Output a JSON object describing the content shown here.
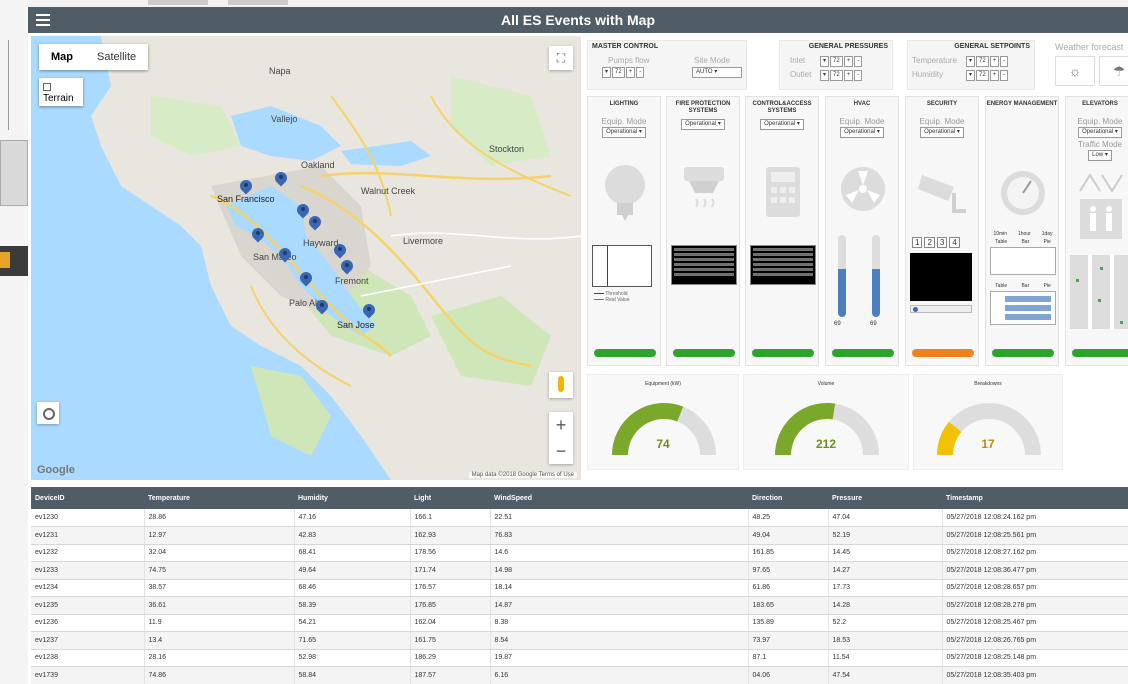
{
  "app": {
    "title": "All ES Events with Map"
  },
  "map": {
    "type_tabs": [
      "Map",
      "Satellite"
    ],
    "terrain_label": "Terrain",
    "google_logo": "Google",
    "terms": "Map data ©2018 Google  Terms of Use",
    "zoom_in": "+",
    "zoom_out": "−",
    "labels": [
      "San Francisco",
      "San Jose",
      "Oakland",
      "Hayward",
      "Fremont",
      "Walnut Creek",
      "Stockton",
      "Napa",
      "Vallejo",
      "Palo Alto",
      "San Mateo",
      "Livermore"
    ],
    "pin_count": 11
  },
  "master": {
    "header": "MASTER CONTROL",
    "pumps_label": "Pumps flow",
    "pumps_value": "72",
    "site_label": "Site Mode",
    "site_value": "AUTO"
  },
  "pressures": {
    "header": "GENERAL PRESSURES",
    "inlet_label": "Inlet",
    "inlet_value": "72",
    "outlet_label": "Outlet",
    "outlet_value": "72"
  },
  "setpoints": {
    "header": "GENERAL SETPOINTS",
    "temp_label": "Temperature",
    "temp_value": "72",
    "hum_label": "Humidity",
    "hum_value": "72"
  },
  "weather": {
    "label": "Weather forecast"
  },
  "systems": [
    {
      "name": "LIGHTING",
      "mode_label": "Equip. Mode",
      "mode": "Operational",
      "status": "green",
      "legend1": "Threshold",
      "legend2": "Real Value"
    },
    {
      "name": "FIRE PROTECTION SYSTEMS",
      "mode_label": "Equip. Mode",
      "mode": "Operational",
      "status": "green"
    },
    {
      "name": "CONTROL&ACCESS SYSTEMS",
      "mode_label": "Equip. Mode",
      "mode": "Operational",
      "status": "green"
    },
    {
      "name": "HVAC",
      "mode_label": "Equip. Mode",
      "mode": "Operational",
      "status": "green",
      "t1": "69",
      "t2": "69"
    },
    {
      "name": "SECURITY",
      "mode_label": "Equip. Mode",
      "mode": "Operational",
      "status": "orange",
      "cams": [
        "1",
        "2",
        "3",
        "4"
      ]
    },
    {
      "name": "ENERGY MANAGEMENT",
      "status": "green",
      "tabs": [
        "10min",
        "1hour",
        "1day"
      ],
      "table_tabs": [
        "Table",
        "Bar",
        "Pie"
      ]
    },
    {
      "name": "ELEVATORS",
      "mode_label": "Equip. Mode",
      "mode": "Operational",
      "traffic_label": "Traffic Mode",
      "traffic": "Low",
      "status": "green"
    }
  ],
  "gauges": [
    {
      "title": "Equipment (kW)",
      "value": "74",
      "fraction": 0.62,
      "color": "#7aa82a"
    },
    {
      "title": "Volume",
      "value": "212",
      "fraction": 0.55,
      "color": "#7aa82a"
    },
    {
      "title": "Breakdowns",
      "value": "17",
      "fraction": 0.22,
      "color": "#f2c200"
    }
  ],
  "table": {
    "columns": [
      "DeviceID",
      "Temperature",
      "Humidity",
      "Light",
      "WindSpeed",
      "Direction",
      "Pressure",
      "Timestamp"
    ],
    "rows": [
      [
        "ev1230",
        "28.86",
        "47.16",
        "166.1",
        "22.51",
        "48.25",
        "47.04",
        "05/27/2018 12:08:24.162 pm"
      ],
      [
        "ev1231",
        "12.97",
        "42.83",
        "162.93",
        "76.83",
        "49.04",
        "52.19",
        "05/27/2018 12:08:25.561 pm"
      ],
      [
        "ev1232",
        "32.04",
        "68.41",
        "178.56",
        "14.6",
        "161.85",
        "14.45",
        "05/27/2018 12:08:27.162 pm"
      ],
      [
        "ev1233",
        "74.75",
        "49.64",
        "171.74",
        "14.98",
        "97.65",
        "14.27",
        "05/27/2018 12:08:36.477 pm"
      ],
      [
        "ev1234",
        "38.57",
        "68.46",
        "176.57",
        "18.14",
        "61.86",
        "17.73",
        "05/27/2018 12:08:28.657 pm"
      ],
      [
        "ev1235",
        "36.61",
        "58.39",
        "176.85",
        "14.87",
        "183.65",
        "14.28",
        "05/27/2018 12:08:28.278 pm"
      ],
      [
        "ev1236",
        "11.9",
        "54.21",
        "162.04",
        "8.38",
        "135.89",
        "52.2",
        "05/27/2018 12:08:25.467 pm"
      ],
      [
        "ev1237",
        "13.4",
        "71.65",
        "161.75",
        "8.54",
        "73.97",
        "18.53",
        "05/27/2018 12:08:26.765 pm"
      ],
      [
        "ev1238",
        "28.16",
        "52.98",
        "186.29",
        "19.87",
        "87.1",
        "11.54",
        "05/27/2018 12:08:25.148 pm"
      ],
      [
        "ev1739",
        "74.86",
        "58.84",
        "187.57",
        "6.16",
        "04.06",
        "47.54",
        "05/27/2018 12:08:35.403 pm"
      ]
    ]
  }
}
